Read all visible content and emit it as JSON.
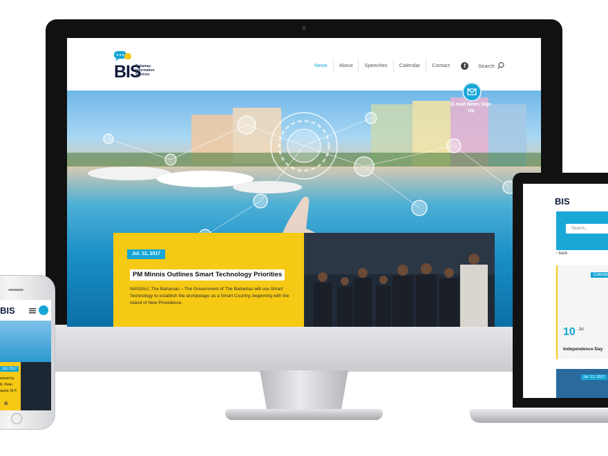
{
  "desktop": {
    "logo": {
      "text": "BIS",
      "subtitle": "Bahamas Information Services"
    },
    "nav": {
      "items": [
        "News",
        "About",
        "Speeches",
        "Calendar",
        "Contact"
      ],
      "active": "News",
      "search_label": "Search"
    },
    "email_signup": {
      "label": "E-mail News Sign Up"
    },
    "news": {
      "date": "Jul. 12, 2017",
      "title": "PM Minnis Outlines Smart Technology Priorities",
      "excerpt": "NASSAU, The Bahamas – The Government of The Bahamas will use Smart Technology to establish the archipelago as a Smart Country, beginning with the island of New Providence."
    }
  },
  "phone": {
    "date": "JUL 2017",
    "text_lines": [
      "ement by",
      "R. Peter",
      "quest, M.P."
    ],
    "pager": "/5"
  },
  "laptop": {
    "logo": "BIS",
    "search_placeholder": "Search...",
    "back_label": "back",
    "calendar_tab": "Calendar",
    "event": {
      "day": "10",
      "month": "Jul.",
      "title": "Independence Day"
    },
    "thumb_date": "Jul. 12, 2017"
  },
  "colors": {
    "brand_blue": "#16a6d6",
    "brand_yellow": "#f6c915",
    "brand_navy": "#0e1a3a"
  },
  "icons": [
    "speech-bubble-logo-icon",
    "facebook-icon",
    "search-icon",
    "envelope-icon",
    "hamburger-menu-icon",
    "back-arrow-icon"
  ]
}
